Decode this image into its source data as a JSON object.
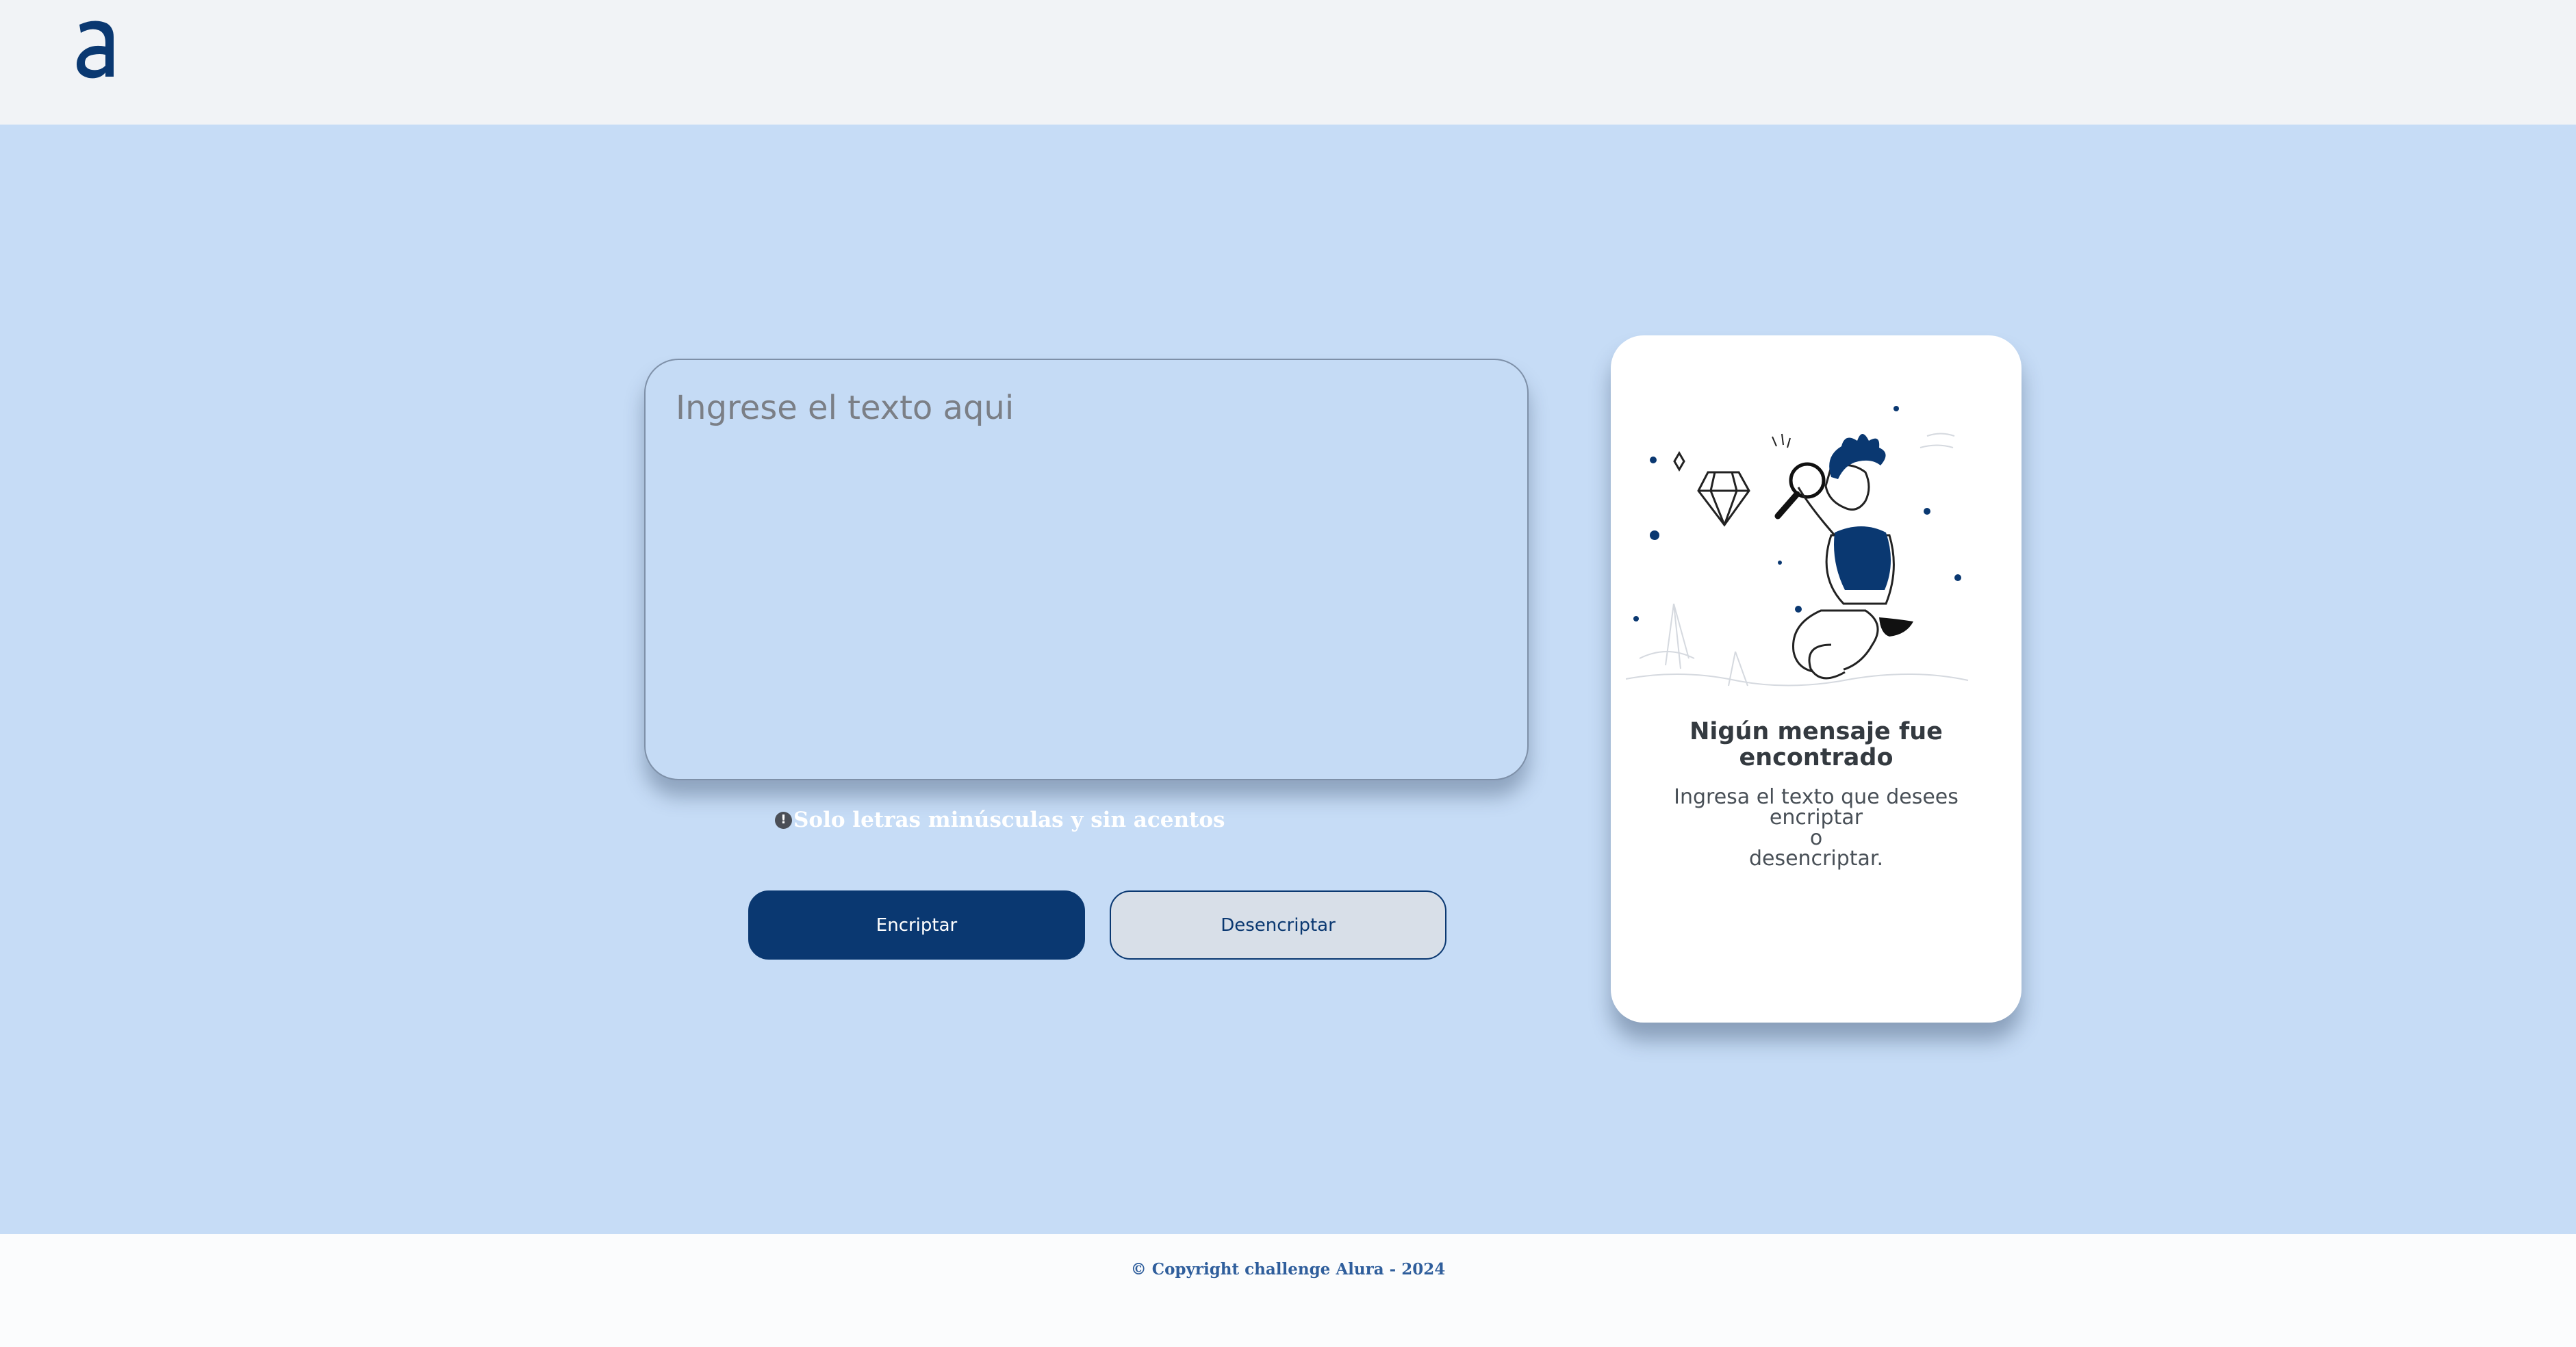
{
  "header": {
    "logo_letter": "a"
  },
  "input": {
    "placeholder": "Ingrese el texto aqui"
  },
  "hint": {
    "icon": "info-circle-icon",
    "icon_glyph": "!",
    "text": "Solo letras minúsculas y sin acentos"
  },
  "buttons": {
    "encrypt_label": "Encriptar",
    "decrypt_label": "Desencriptar"
  },
  "output_card": {
    "illustration": "person-with-magnifying-glass-illustration",
    "title": "Nigún mensaje fue encontrado",
    "body_line1": "Ingresa el texto que desees encriptar",
    "body_line2": "o",
    "body_line3": "desencriptar."
  },
  "footer": {
    "text": "© Copyright challenge Alura - 2024"
  },
  "colors": {
    "primary": "#0a3871",
    "background": "#c6dcf6",
    "header_bg": "#f1f3f6",
    "card_bg": "#ffffff"
  }
}
